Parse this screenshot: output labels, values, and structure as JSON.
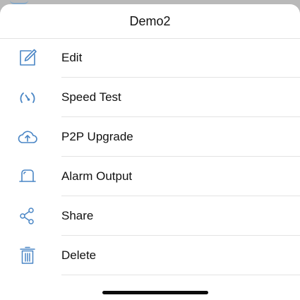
{
  "sheet": {
    "title": "Demo2"
  },
  "menu": {
    "items": [
      {
        "label": "Edit",
        "icon": "edit-icon"
      },
      {
        "label": "Speed Test",
        "icon": "speedometer-icon"
      },
      {
        "label": "P2P Upgrade",
        "icon": "cloud-upload-icon"
      },
      {
        "label": "Alarm Output",
        "icon": "alarm-light-icon"
      },
      {
        "label": "Share",
        "icon": "share-icon"
      },
      {
        "label": "Delete",
        "icon": "trash-icon"
      }
    ]
  },
  "colors": {
    "icon_accent": "#4a86c5",
    "text": "#111111",
    "divider": "#e3e3e3",
    "backdrop": "#b9b9b9"
  }
}
